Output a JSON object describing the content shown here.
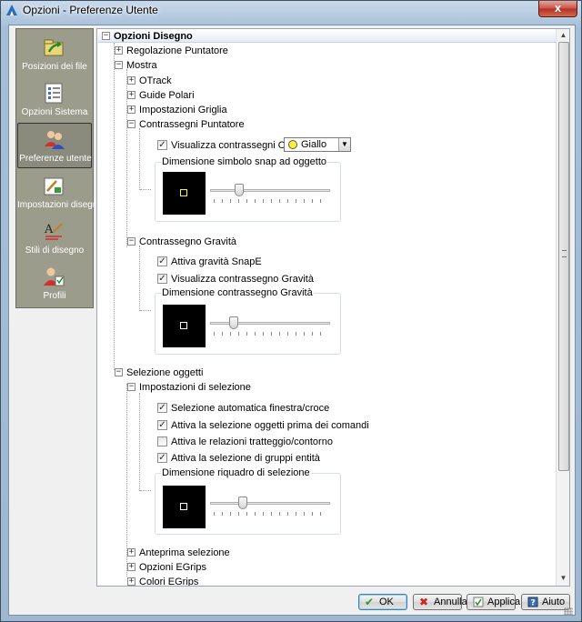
{
  "window": {
    "title": "Opzioni - Preferenze Utente",
    "close_glyph": "x"
  },
  "sidebar": {
    "items": [
      {
        "label": "Posizioni dei file",
        "icon": "folder-arrow-icon"
      },
      {
        "label": "Opzioni Sistema",
        "icon": "checklist-icon"
      },
      {
        "label": "Preferenze utente",
        "icon": "users-icon",
        "selected": true
      },
      {
        "label": "Impostazioni disegno",
        "icon": "drawing-settings-icon"
      },
      {
        "label": "Stili di disegno",
        "icon": "text-style-icon"
      },
      {
        "label": "Profili",
        "icon": "profile-icon"
      }
    ]
  },
  "tree": {
    "root": "Opzioni Disegno",
    "regolazione": "Regolazione Puntatore",
    "mostra": "Mostra",
    "otrack": "OTrack",
    "guide": "Guide Polari",
    "griglia": "Impostazioni Griglia",
    "contrassegni": {
      "label": "Contrassegni Puntatore",
      "osnap_label": "Visualizza contrassegni OSnap",
      "osnap_checked": true,
      "color_value": "Giallo",
      "color_hex": "#ffee33",
      "group_title": "Dimensione simbolo snap ad oggetto",
      "slider_fraction": 0.22
    },
    "gravita": {
      "label": "Contrassegno Gravità",
      "snape_label": "Attiva gravità SnapE",
      "snape_checked": true,
      "show_label": "Visualizza contrassegno Gravità",
      "show_checked": true,
      "group_title": "Dimensione contrassegno Gravità",
      "slider_fraction": 0.17
    },
    "selezione": {
      "label": "Selezione oggetti",
      "impostazioni": "Impostazioni di selezione",
      "options": [
        {
          "label": "Selezione automatica finestra/croce",
          "checked": true
        },
        {
          "label": "Attiva la selezione oggetti prima dei comandi",
          "checked": true
        },
        {
          "label": "Attiva le relazioni tratteggio/contorno",
          "checked": false
        },
        {
          "label": "Attiva la selezione di gruppi entità",
          "checked": true
        }
      ],
      "group_title": "Dimensione riquadro di selezione",
      "slider_fraction": 0.25
    },
    "anteprima": "Anteprima selezione",
    "egrips": "Opzioni EGrips",
    "colori": "Colori EGrips"
  },
  "buttons": {
    "ok": "OK",
    "annulla": "Annulla",
    "applica": "Applica",
    "aiuto": "Aiuto"
  }
}
